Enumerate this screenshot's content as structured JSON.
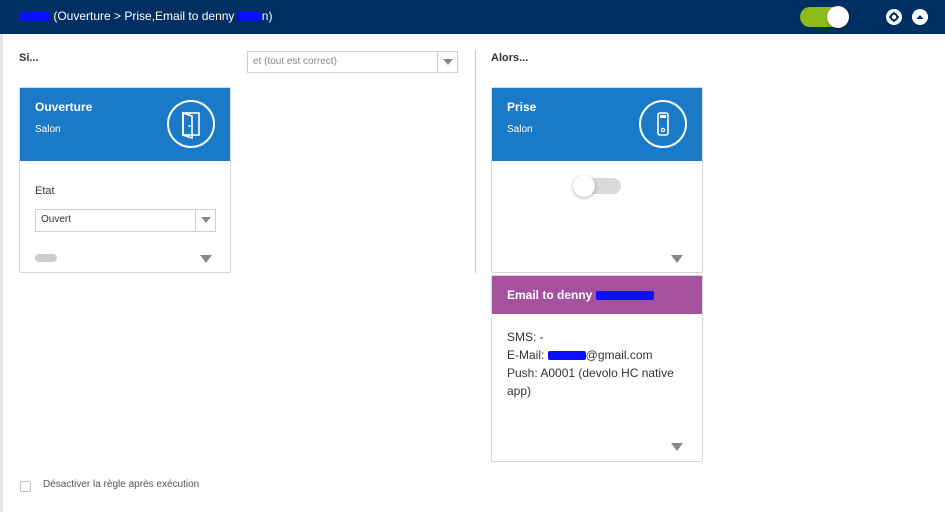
{
  "header": {
    "rule_name_redacted": "",
    "rule_description": "(Ouverture > Prise,Email to denny",
    "rule_description_end": "n)",
    "toggle_state": "on",
    "settings_icon": "gear-icon",
    "collapse_icon": "chevron-up-icon"
  },
  "conditions": {
    "label": "Si...",
    "operator_select": "et (tout est correct)",
    "card": {
      "title": "Ouverture",
      "room": "Salon",
      "icon": "door-icon",
      "state_label": "Etat",
      "state_value": "Ouvert"
    }
  },
  "actions": {
    "label": "Alors...",
    "plug_card": {
      "title": "Prise",
      "room": "Salon",
      "icon": "plug-icon",
      "switch_state": "off"
    },
    "email_card": {
      "title": "Email to denny",
      "sms": "SMS: -",
      "email_prefix": "E-Mail: ",
      "email_suffix": "@gmail.com",
      "push": "Push: A0001 (devolo HC native app)"
    }
  },
  "footer": {
    "disable_after_label": "Désactiver la règle après exécution",
    "disable_after_checked": false
  },
  "colors": {
    "header_bg": "#003063",
    "toggle_on": "#8ebb1c",
    "card_blue": "#1a7ac7",
    "card_purple": "#a6519e"
  }
}
